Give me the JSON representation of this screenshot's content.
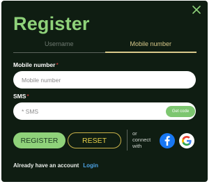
{
  "dialog": {
    "title": "Register"
  },
  "tabs": [
    {
      "label": "Username",
      "active": false
    },
    {
      "label": "Mobile number",
      "active": true
    }
  ],
  "mobile": {
    "label": "Mobile number",
    "required_mark": "*",
    "placeholder": "Mobile number",
    "value": ""
  },
  "sms": {
    "label": "SMS",
    "required_mark": "*",
    "placeholder": "* SMS",
    "value": "",
    "get_code_label": "Get code"
  },
  "actions": {
    "register_label": "REGISTER",
    "reset_label": "RESET"
  },
  "connect": {
    "lines": [
      "or",
      "connect",
      "with"
    ],
    "icons": [
      "facebook-icon",
      "google-icon"
    ]
  },
  "footer": {
    "text": "Already have an account",
    "login_label": "Login"
  },
  "colors": {
    "background": "#0f1d12",
    "accent_green": "#8fd27a",
    "accent_gold": "#d8c98a",
    "reset_yellow": "#e6cf4a",
    "link_blue": "#4da3e6",
    "required_red": "#e04040",
    "facebook_blue": "#1877f2"
  }
}
